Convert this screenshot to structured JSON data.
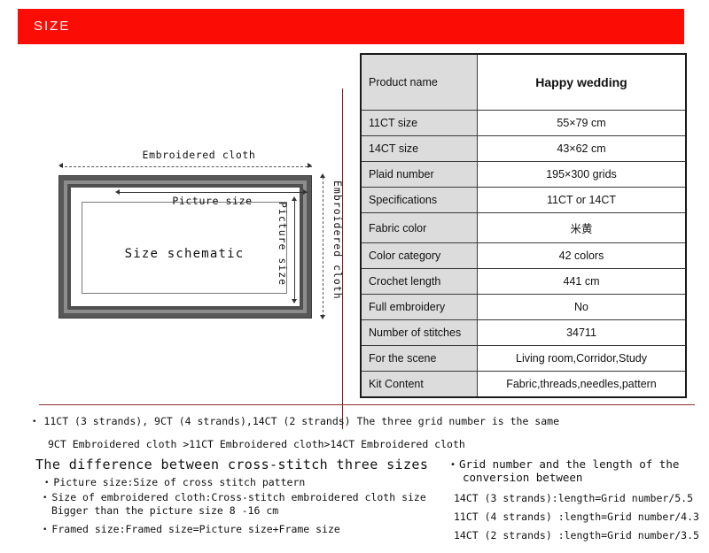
{
  "header": {
    "title": "SIZE",
    "bar_color": "#fb0d06",
    "text_color": "#ffffff"
  },
  "schematic": {
    "top_label": "Embroidered cloth",
    "inner_horizontal_label": "Picture size",
    "inner_vertical_label": "Picture size",
    "outer_vertical_label": "Embroidered cloth",
    "center_label": "Size schematic",
    "frame_color": "#585858",
    "frame_inner_color": "#8d8d8d"
  },
  "spec_table": {
    "rows": [
      {
        "label": "Product name",
        "value": "Happy wedding"
      },
      {
        "label": "11CT size",
        "value": "55×79 cm"
      },
      {
        "label": "14CT size",
        "value": "43×62 cm"
      },
      {
        "label": "Plaid number",
        "value": "195×300 grids"
      },
      {
        "label": "Specifications",
        "value": "11CT or 14CT"
      },
      {
        "label": "Fabric color",
        "value": "米黄"
      },
      {
        "label": "Color category",
        "value": "42 colors"
      },
      {
        "label": "Crochet length",
        "value": "441 cm"
      },
      {
        "label": "Full embroidery",
        "value": "No"
      },
      {
        "label": "Number of stitches",
        "value": "34711"
      },
      {
        "label": "For the scene",
        "value": "Living room,Corridor,Study"
      },
      {
        "label": "Kit Content",
        "value": "Fabric,threads,needles,pattern"
      }
    ],
    "label_bg": "#dcdcdc",
    "border_color": "#1a1a1a"
  },
  "notes": {
    "line_1": "11CT  (3 strands), 9CT  (4 strands),14CT (2 strands)  The three grid number is the same",
    "line_2": "9CT Embroidered cloth >11CT Embroidered cloth>14CT Embroidered cloth",
    "bullet_glyph": "•"
  },
  "bottom_left": {
    "heading": "The difference between cross-stitch three sizes",
    "item_1": "Picture size:Size of cross stitch pattern",
    "item_2": "Size of embroidered cloth:Cross-stitch embroidered cloth size",
    "item_2_cont": "Bigger than the picture size 8 -16 cm",
    "item_3": "Framed size:Framed size=Picture size+Frame size"
  },
  "bottom_right": {
    "heading": "Grid number and the length of the",
    "heading_2": "conversion between",
    "item_1": "14CT  (3 strands):length=Grid number/5.5",
    "item_2": "11CT  (4 strands) :length=Grid number/4.3",
    "item_3": "14CT (2 strands) :length=Grid number/3.5"
  }
}
